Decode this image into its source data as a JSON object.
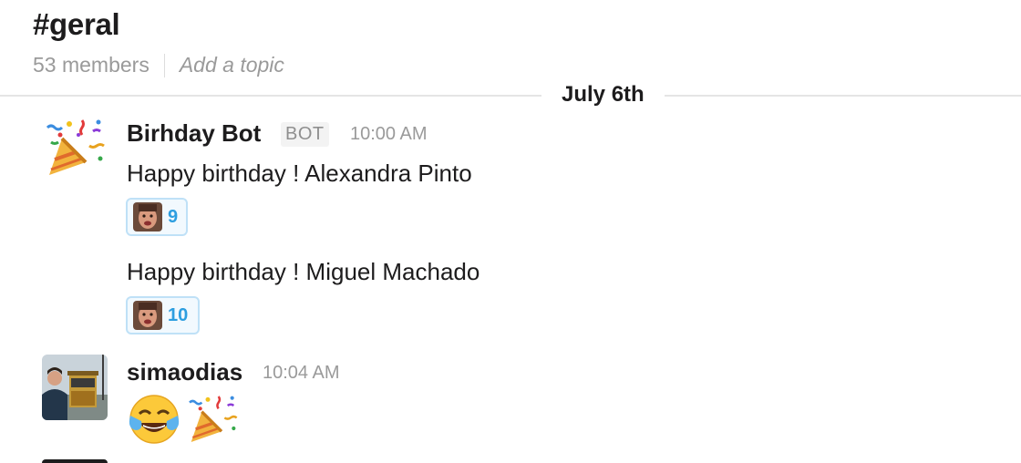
{
  "channel": {
    "name": "#geral",
    "members": "53 members",
    "topic_placeholder": "Add a topic"
  },
  "day_divider": "July 6th",
  "messages": [
    {
      "sender": "Birhday Bot",
      "badge": "BOT",
      "time": "10:00 AM",
      "avatar_icon": "party-popper-icon",
      "lines": [
        {
          "text": "Happy birthday ! Alexandra Pinto",
          "reaction_count": "9"
        },
        {
          "text": "Happy birthday ! Miguel Machado",
          "reaction_count": "10"
        }
      ]
    },
    {
      "sender": "simaodias",
      "time": "10:04 AM",
      "avatar_icon": "user-photo-avatar",
      "emojis": [
        "tears-of-joy-icon",
        "party-popper-icon"
      ]
    }
  ],
  "colors": {
    "reaction_border": "#bfe1f7",
    "reaction_bg": "#f2f9fe",
    "reaction_count": "#2d9ee0",
    "muted": "#9a9a9a"
  }
}
